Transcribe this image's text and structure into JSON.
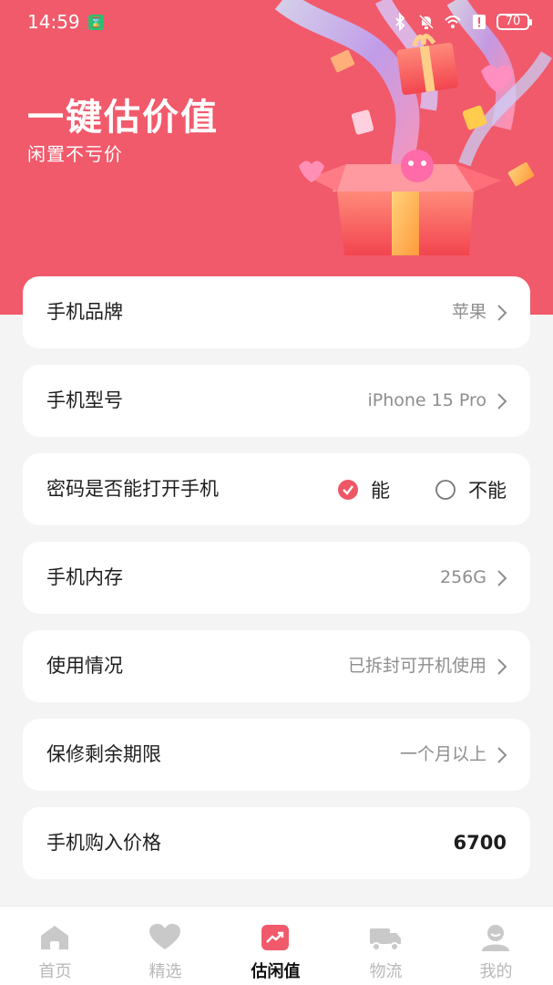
{
  "status_bar": {
    "time": "14:59",
    "battery": "70"
  },
  "hero": {
    "title": "一键估价值",
    "subtitle": "闲置不亏价"
  },
  "form": {
    "brand": {
      "label": "手机品牌",
      "value": "苹果"
    },
    "model": {
      "label": "手机型号",
      "value": "iPhone 15 Pro"
    },
    "password": {
      "label": "密码是否能打开手机",
      "options": [
        "能",
        "不能"
      ],
      "selected": "能"
    },
    "storage": {
      "label": "手机内存",
      "value": "256G"
    },
    "condition": {
      "label": "使用情况",
      "value": "已拆封可开机使用"
    },
    "warranty": {
      "label": "保修剩余期限",
      "value": "一个月以上"
    },
    "price": {
      "label": "手机购入价格",
      "value": "6700"
    }
  },
  "tabbar": {
    "items": [
      {
        "label": "首页",
        "icon": "home-icon"
      },
      {
        "label": "精选",
        "icon": "heart-icon"
      },
      {
        "label": "估闲值",
        "icon": "trend-chart-icon"
      },
      {
        "label": "物流",
        "icon": "truck-icon"
      },
      {
        "label": "我的",
        "icon": "user-icon"
      }
    ],
    "active_index": 2
  },
  "colors": {
    "accent": "#f15a6b",
    "background": "#f4f4f4"
  }
}
